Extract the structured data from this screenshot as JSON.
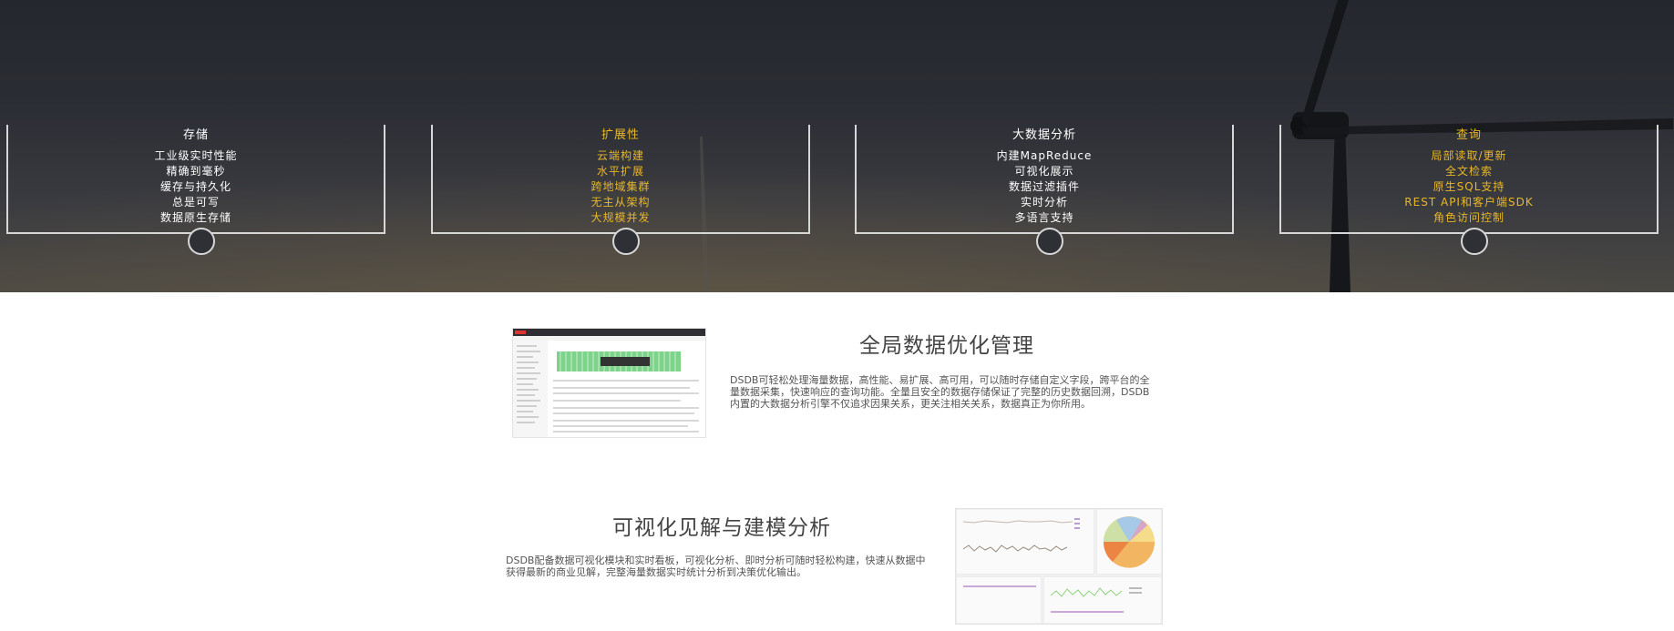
{
  "features": [
    {
      "title": "存储",
      "items": [
        "工业级实时性能",
        "精确到毫秒",
        "缓存与持久化",
        "总是可写",
        "数据原生存储"
      ],
      "accent": false
    },
    {
      "title": "扩展性",
      "items": [
        "云端构建",
        "水平扩展",
        "跨地域集群",
        "无主从架构",
        "大规模并发"
      ],
      "accent": true
    },
    {
      "title": "大数据分析",
      "items": [
        "内建MapReduce",
        "可视化展示",
        "数据过滤插件",
        "实时分析",
        "多语言支持"
      ],
      "accent": false
    },
    {
      "title": "查询",
      "items": [
        "局部读取/更新",
        "全文检索",
        "原生SQL支持",
        "REST API和客户端SDK",
        "角色访问控制"
      ],
      "accent": true
    }
  ],
  "section1": {
    "heading": "全局数据优化管理",
    "text": "DSDB可轻松处理海量数据，高性能、易扩展、高可用，可以随时存储自定义字段，跨平台的全量数据采集，快速响应的查询功能。全量且安全的数据存储保证了完整的历史数据回溯，DSDB内置的大数据分析引擎不仅追求因果关系，更关注相关关系，数据真正为你所用。"
  },
  "section2": {
    "heading": "可视化见解与建模分析",
    "text": "DSDB配备数据可视化模块和实时看板，可视化分析、即时分析可随时轻松构建，快速从数据中获得最新的商业见解，完整海量数据实时统计分析到决策优化输出。"
  },
  "colors": {
    "accent": "#e8b726",
    "line": "#d7d7d7"
  }
}
